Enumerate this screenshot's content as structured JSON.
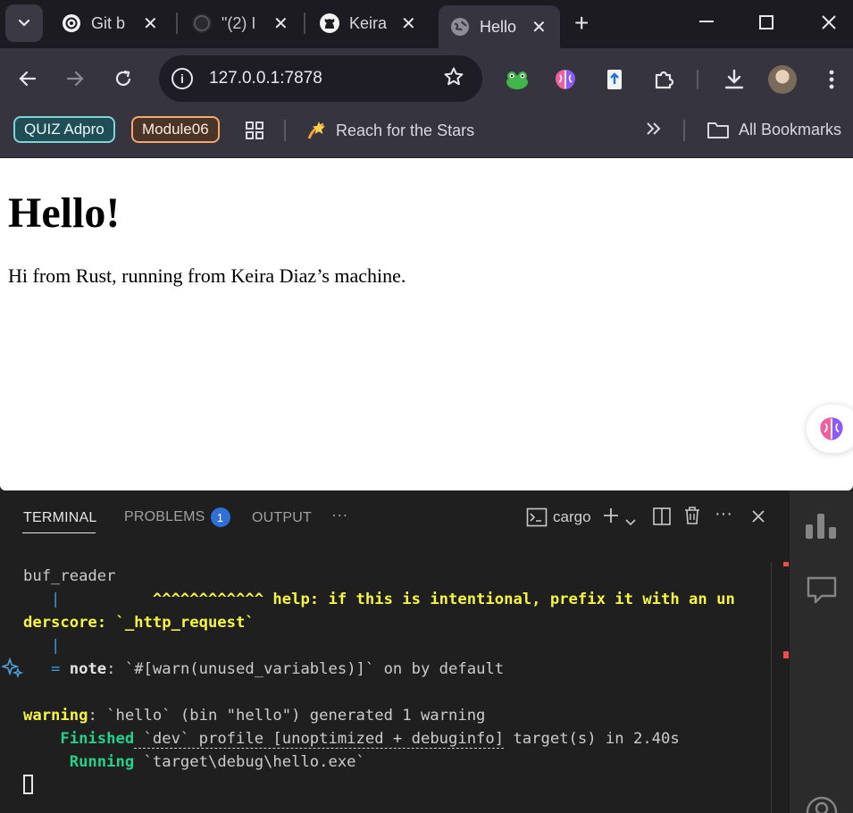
{
  "browser": {
    "tabs": [
      {
        "title": "Git b",
        "icon": "openai-icon",
        "active": false
      },
      {
        "title": "\"(2) I",
        "icon": "github-icon",
        "active": false
      },
      {
        "title": "Keira",
        "icon": "github-icon",
        "active": false
      },
      {
        "title": "Hello",
        "icon": "globe-icon",
        "active": true
      }
    ],
    "close_glyph": "✕",
    "new_tab_glyph": "+",
    "url": "127.0.0.1:7878",
    "bookmarks": {
      "quiz": "QUIZ Adpro",
      "module": "Module06",
      "reach": "Reach for the Stars",
      "all": "All Bookmarks"
    }
  },
  "page": {
    "heading": "Hello!",
    "paragraph": "Hi from Rust, running from Keira Diaz’s machine."
  },
  "panel": {
    "tabs": {
      "terminal": "TERMINAL",
      "problems": "PROBLEMS",
      "problems_count": "1",
      "output": "OUTPUT",
      "more": "···"
    },
    "terminal_name": "cargo",
    "lines": {
      "l1": "buf_reader",
      "l2_pipe": "   |",
      "l2_carets": "          ^^^^^^^^^^^^ help: if this is intentional, prefix it with an un",
      "l3": "derscore: `_http_request`",
      "l4_pipe": "   |",
      "l5_eq": "   = ",
      "l5_note": "note",
      "l5_rest": ": `#[warn(unused_variables)]` on by default",
      "l7_warning": "warning",
      "l7_rest": ": `hello` (bin \"hello\") generated 1 warning",
      "l8_finished": "    Finished",
      "l8_rest_a": " `dev` profile [unoptimized + debuginfo]",
      "l8_rest_b": " target(s) in 2.40s",
      "l9_running": "     Running",
      "l9_rest": " `target\\debug\\hello.exe`"
    }
  },
  "colors": {
    "accent_blue": "#2f6fd6",
    "warn_yellow": "#f5f543",
    "ok_green": "#23d18b"
  }
}
